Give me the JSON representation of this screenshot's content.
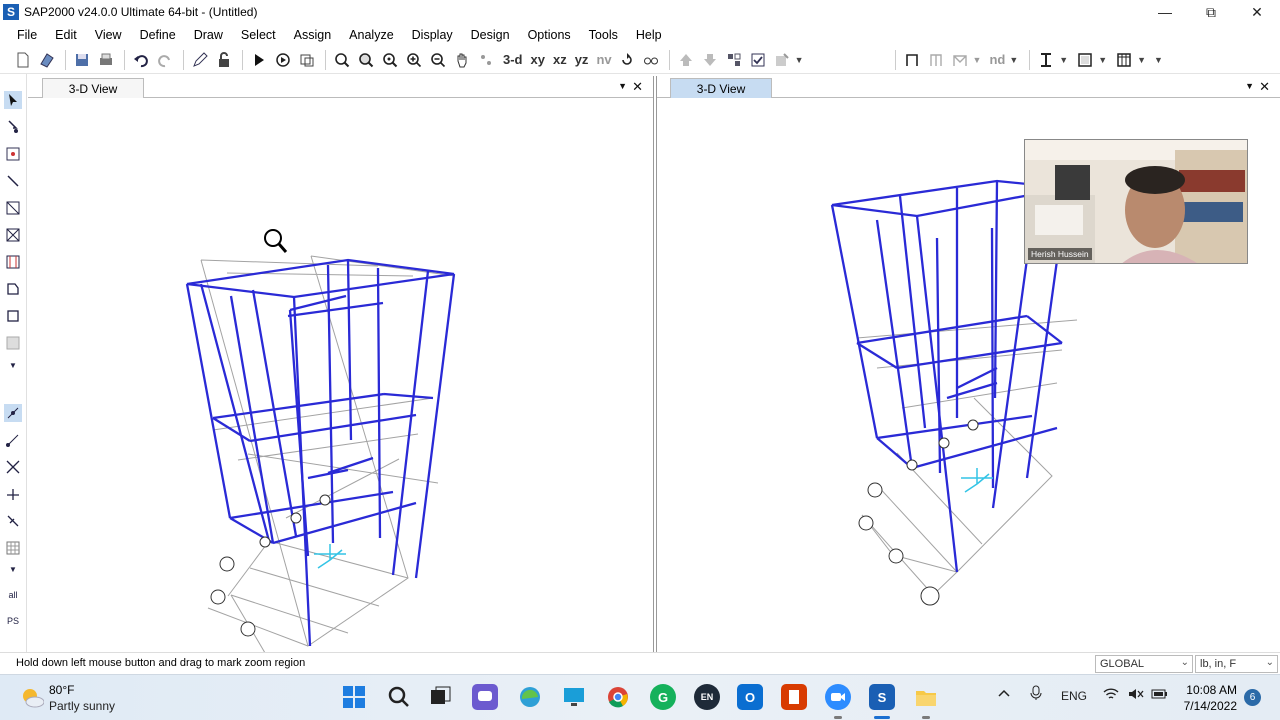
{
  "window": {
    "title": "SAP2000 v24.0.0 Ultimate 64-bit - (Untitled)",
    "logo_letter": "S",
    "controls": [
      "minimize-icon",
      "restore-icon",
      "close-icon"
    ]
  },
  "menu": [
    "File",
    "Edit",
    "View",
    "Define",
    "Draw",
    "Select",
    "Assign",
    "Analyze",
    "Display",
    "Design",
    "Options",
    "Tools",
    "Help"
  ],
  "toolbar": {
    "view_buttons": [
      "3-d",
      "xy",
      "xz",
      "yz",
      "nv"
    ],
    "nd_label": "nd"
  },
  "panes": {
    "left": {
      "title": "3-D View",
      "active": false
    },
    "right": {
      "title": "3-D View",
      "active": true
    }
  },
  "webcam": {
    "name": "Herish Hussein"
  },
  "status": {
    "message": "Hold down left mouse button and drag to mark zoom region",
    "coord_system": "GLOBAL",
    "units": "lb, in, F"
  },
  "lefttoolbar": {
    "all_label": "all",
    "ps_label": "PS"
  },
  "taskbar": {
    "weather_temp": "80°F",
    "weather_desc": "Partly sunny",
    "language": "ENG",
    "time": "10:08 AM",
    "date": "7/14/2022",
    "notifications": "6",
    "lang_badge": "EN"
  },
  "colors": {
    "frame_blue": "#2222cc",
    "grid_gray": "#a0a0a0",
    "support_cyan": "#33c4e6",
    "active_tab": "#c7dcf2"
  }
}
